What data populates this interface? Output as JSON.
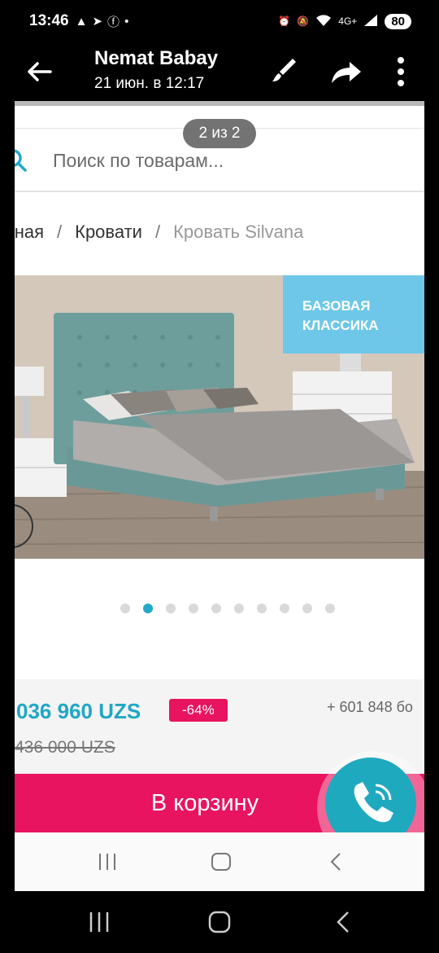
{
  "status_bar": {
    "time": "13:46",
    "battery": "80",
    "network": "4G+"
  },
  "viewer": {
    "sender": "Nemat Babay",
    "timestamp": "21 июн. в 12:17",
    "url_ghost": "askona.uz/ru/krovat",
    "counter": "2 из 2"
  },
  "page": {
    "search_placeholder": "Поиск по товарам...",
    "breadcrumb": [
      "вная",
      "Кровати",
      "Кровать Silvana"
    ],
    "breadcrumb_sep": "/",
    "badge_line1": "БАЗОВАЯ",
    "badge_line2": "КЛАССИКА",
    "gallery": {
      "total": 10,
      "active": 1
    },
    "price_now": "036 960  UZS",
    "discount": "-64%",
    "bonus": "+ 601 848  бо",
    "price_old": "436 000  UZS",
    "cart_button": "В корзину"
  },
  "colors": {
    "brand_pink": "#e8145f",
    "brand_teal": "#20a7c4",
    "badge_blue": "#6ec7e8"
  }
}
